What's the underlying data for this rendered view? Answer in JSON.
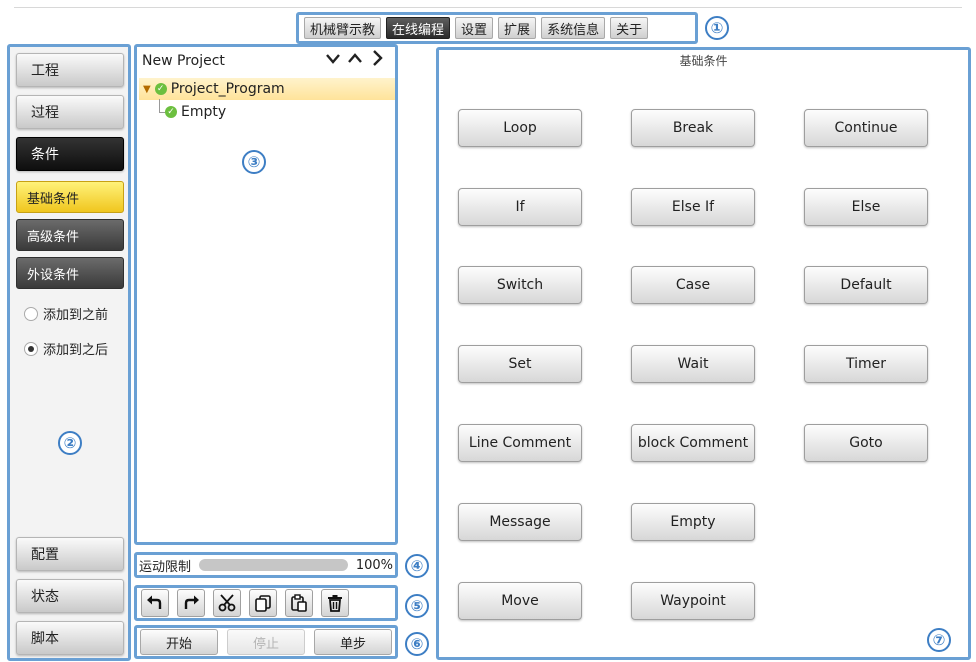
{
  "top_nav": {
    "tabs": [
      {
        "label": "机械臂示教",
        "active": false
      },
      {
        "label": "在线编程",
        "active": true
      },
      {
        "label": "设置",
        "active": false
      },
      {
        "label": "扩展",
        "active": false
      },
      {
        "label": "系统信息",
        "active": false
      },
      {
        "label": "关于",
        "active": false
      }
    ]
  },
  "callouts": [
    "①",
    "②",
    "③",
    "④",
    "⑤",
    "⑥",
    "⑦"
  ],
  "sidebar": {
    "project": "工程",
    "process": "过程",
    "condition": "条件",
    "sub_basic": "基础条件",
    "sub_advanced": "高级条件",
    "sub_peripheral": "外设条件",
    "radio_before": "添加到之前",
    "radio_after": "添加到之后",
    "radio_selected": "添加到之后",
    "config": "配置",
    "status": "状态",
    "script": "脚本"
  },
  "tree": {
    "header": "New Project",
    "root": "Project_Program",
    "child": "Empty"
  },
  "progress": {
    "label": "运动限制",
    "value_text": "100%",
    "fraction": 1.0
  },
  "toolbar": {
    "icons": [
      "undo-icon",
      "redo-icon",
      "cut-icon",
      "copy-icon",
      "paste-icon",
      "delete-icon"
    ]
  },
  "run": {
    "start": "开始",
    "stop": "停止",
    "step": "单步"
  },
  "panel": {
    "title": "基础条件",
    "buttons": [
      "Loop",
      "Break",
      "Continue",
      "If",
      "Else If",
      "Else",
      "Switch",
      "Case",
      "Default",
      "Set",
      "Wait",
      "Timer",
      "Line Comment",
      "block Comment",
      "Goto",
      "Message",
      "Empty",
      "Move",
      "Waypoint"
    ]
  },
  "colors": {
    "callout_blue": "#3d7ec4",
    "frame_blue": "#6aa0d4",
    "selected_yellow": "#f0c61e",
    "check_green": "#6cbf3f"
  }
}
